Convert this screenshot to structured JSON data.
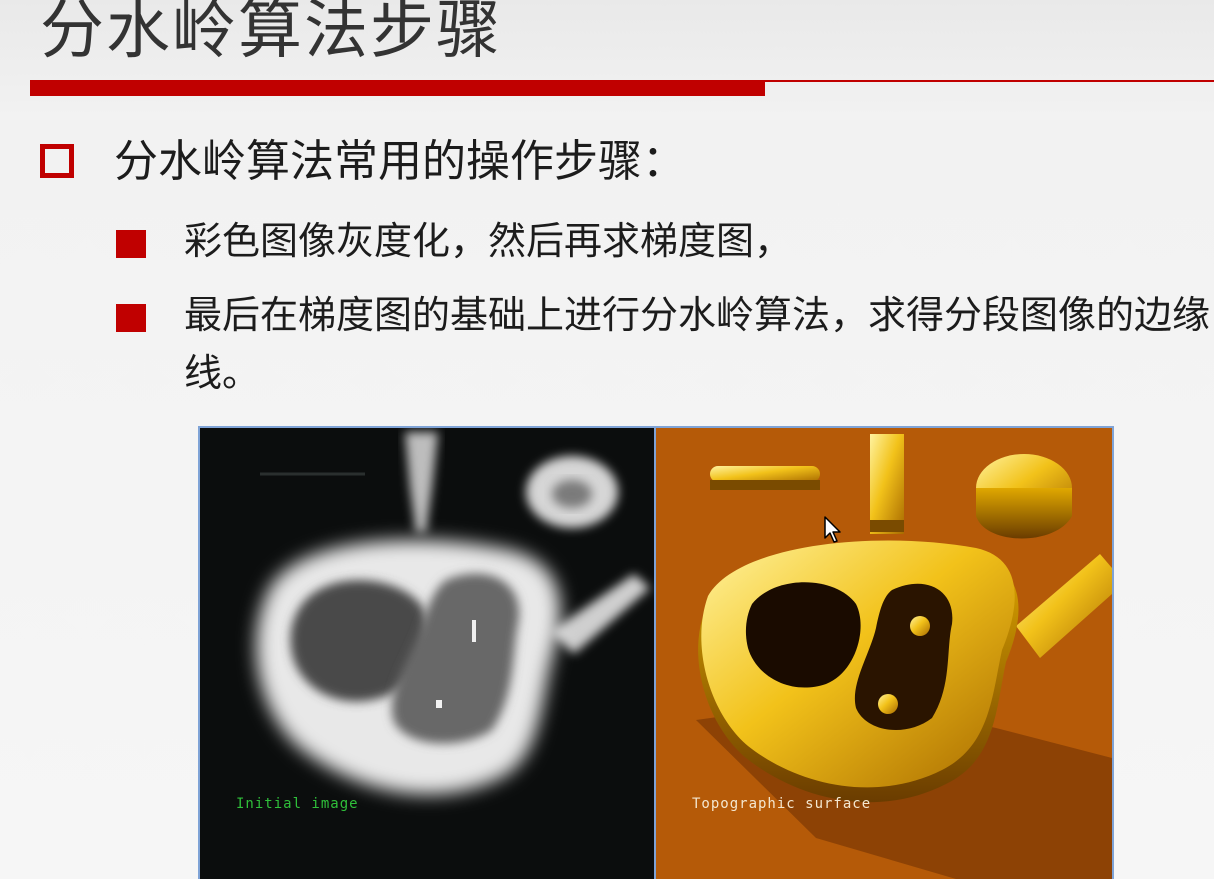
{
  "slide": {
    "title": "分水岭算法步骤",
    "accent_color": "#c00000",
    "bullets": [
      {
        "level": 1,
        "marker": "hollow-square",
        "text": "分水岭算法常用的操作步骤："
      },
      {
        "level": 2,
        "marker": "solid-square",
        "text": "彩色图像灰度化，然后再求梯度图，"
      },
      {
        "level": 2,
        "marker": "solid-square",
        "text": "最后在梯度图的基础上进行分水岭算法，求得分段图像的边缘线。"
      }
    ],
    "figure": {
      "left_caption": "Initial image",
      "right_caption": "Topographic surface",
      "frame_color": "#7fa3d6",
      "left_background": "#0b0d0d",
      "right_background": "#b55a08"
    }
  }
}
